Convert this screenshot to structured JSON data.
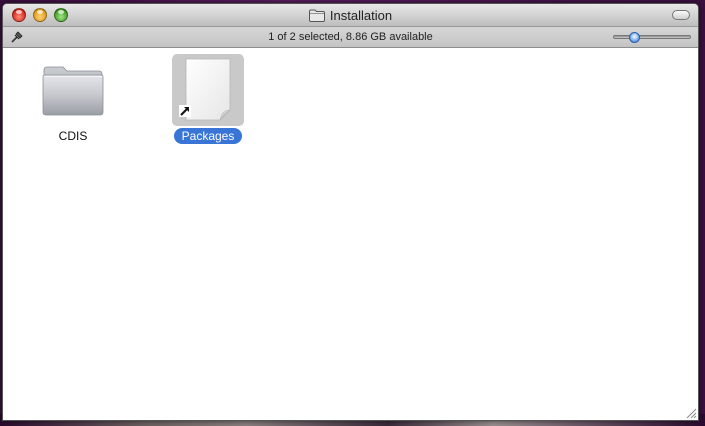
{
  "window": {
    "title": "Installation",
    "status": "1 of 2 selected, 8.86 GB available",
    "icon_size_slider": {
      "value_fraction": 0.27
    }
  },
  "items": [
    {
      "name": "CDIS",
      "kind": "folder",
      "selected": false
    },
    {
      "name": "Packages",
      "kind": "alias-document",
      "selected": true
    }
  ],
  "colors": {
    "selection": "#3875d7",
    "selected_tile": "#c9c9c9",
    "close": "#d3261b",
    "minimize": "#dc9a16",
    "zoom": "#3d9b1e",
    "desktop": "#5a1d5e"
  },
  "icons": {
    "title": "folder-icon",
    "statusbar_left": "pin-icon",
    "alias_badge": "alias-arrow-icon"
  }
}
